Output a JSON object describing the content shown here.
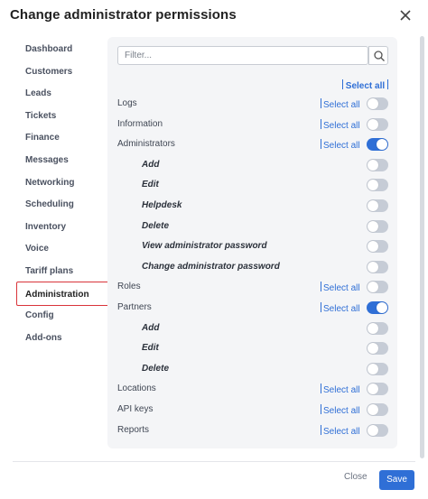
{
  "dialog": {
    "title": "Change administrator permissions"
  },
  "sidebar": {
    "items": [
      {
        "label": "Dashboard"
      },
      {
        "label": "Customers"
      },
      {
        "label": "Leads"
      },
      {
        "label": "Tickets"
      },
      {
        "label": "Finance"
      },
      {
        "label": "Messages"
      },
      {
        "label": "Networking"
      },
      {
        "label": "Scheduling"
      },
      {
        "label": "Inventory"
      },
      {
        "label": "Voice"
      },
      {
        "label": "Tariff plans"
      },
      {
        "label": "Administration",
        "active": true
      },
      {
        "label": "Config"
      },
      {
        "label": "Add-ons"
      }
    ]
  },
  "search": {
    "placeholder": "Filter...",
    "value": ""
  },
  "global_select_all": "Select all",
  "permissions": [
    {
      "label": "Logs",
      "select_all": "Select all",
      "on": false
    },
    {
      "label": "Information",
      "select_all": "Select all",
      "on": false
    },
    {
      "label": "Administrators",
      "select_all": "Select all",
      "on": true
    },
    {
      "label": "Add",
      "sub": true,
      "on": false
    },
    {
      "label": "Edit",
      "sub": true,
      "on": false
    },
    {
      "label": "Helpdesk",
      "sub": true,
      "on": false
    },
    {
      "label": "Delete",
      "sub": true,
      "on": false
    },
    {
      "label": "View administrator password",
      "sub": true,
      "on": false
    },
    {
      "label": "Change administrator password",
      "sub": true,
      "on": false
    },
    {
      "label": "Roles",
      "select_all": "Select all",
      "on": false
    },
    {
      "label": "Partners",
      "select_all": "Select all",
      "on": true
    },
    {
      "label": "Add",
      "sub": true,
      "on": false
    },
    {
      "label": "Edit",
      "sub": true,
      "on": false
    },
    {
      "label": "Delete",
      "sub": true,
      "on": false
    },
    {
      "label": "Locations",
      "select_all": "Select all",
      "on": false
    },
    {
      "label": "API keys",
      "select_all": "Select all",
      "on": false
    },
    {
      "label": "Reports",
      "select_all": "Select all",
      "on": false
    }
  ],
  "footer": {
    "close_label": "Close",
    "save_label": "Save"
  },
  "colors": {
    "accent": "#2f6fd6",
    "active_outline": "#d9343a",
    "toggle_off": "#c6ccd6"
  },
  "icons": {
    "close": "close-icon",
    "search": "search-icon"
  }
}
